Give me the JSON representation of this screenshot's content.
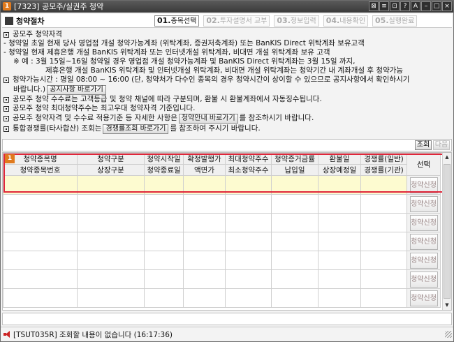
{
  "window": {
    "badge": "1",
    "title": "[7323] 공모주/실권주 청약",
    "controls": [
      "⊠",
      "≡",
      "⊡",
      "?",
      "A",
      "–",
      "□",
      "×"
    ]
  },
  "stephead": {
    "title": "청약절차",
    "steps": [
      {
        "num": "01.",
        "label": "종목선택"
      },
      {
        "num": "02.",
        "label": "투자설명서 교부"
      },
      {
        "num": "03.",
        "label": "정보입력"
      },
      {
        "num": "04.",
        "label": "내용확인"
      },
      {
        "num": "05.",
        "label": "실행완료"
      }
    ]
  },
  "info": {
    "l1": "공모주 청약자격",
    "l2": "- 청약일 초일 현재 당사 영업점 개설 청약가능계좌 (위탁계좌, 증권저축계좌) 또는 BanKIS Direct 위탁계좌 보유고객",
    "l3": "- 청약일 현재 제휴은행 개설 BanKIS 위탁계좌 또는 인터넷개설 위탁계좌, 비대면 개설 위탁계좌 보유 고객",
    "l4": "※ 예 :  3월 15일~16일 청약일 경우 영업점 개설 청약가능계좌 및 BanKIS Direct 위탁계좌는 3월 15일 까지,",
    "l5": "제휴은행 개설 BanKIS 위탁계좌 및 인터넷개설 위탁계좌, 비대면 개설 위탁계좌는 청약기간 내 계좌개설 후 청약가능",
    "l6": "청약가능시간 : 평일 08:00 ~ 16:00 (단, 청약처가 다수인  종목의 경우  청약시간이 상이할 수 있으므로 공지사항에서 확인하시기",
    "l7a": "바랍니다.)",
    "l7btn": "공지사항 바로가기",
    "l8": "공모주 청약 수수료는 고객등급 및 청약 채널에 따라 구분되며, 환불 시 환불계좌에서 자동징수됩니다.",
    "l9": "공모주 청약 최대청약주수는 최고우대 청약자격 기준입니다.",
    "l10a": "공모주 청약자격 및 수수료 적용기준 등 자세한 사항은",
    "l10btn": "청약안내 바로가기",
    "l10b": "를 참조하시기 바랍니다.",
    "l11a": "통합경쟁률(타사합산) 조회는",
    "l11btn": "경쟁률조회 바로가기",
    "l11b": "를 참조하여 주시기 바랍니다."
  },
  "search": {
    "query_btn": "조회",
    "next_btn": "다음"
  },
  "grid": {
    "badge": "1",
    "header_top": [
      "청약종목명",
      "청약구분",
      "청약시작일",
      "확정발행가",
      "최대청약주수",
      "청약증거금률",
      "환불일",
      "경쟁률(일반)"
    ],
    "header_bottom": [
      "청약종목번호",
      "상장구분",
      "청약종료일",
      "액면가",
      "최소청약주수",
      "납입일",
      "상장예정일",
      "경쟁률(기관)"
    ],
    "select_header": "선택",
    "apply_label": "청약신청"
  },
  "status": {
    "text": "[TSUT035R] 조회할 내용이 없습니다 (16:17:36)"
  }
}
